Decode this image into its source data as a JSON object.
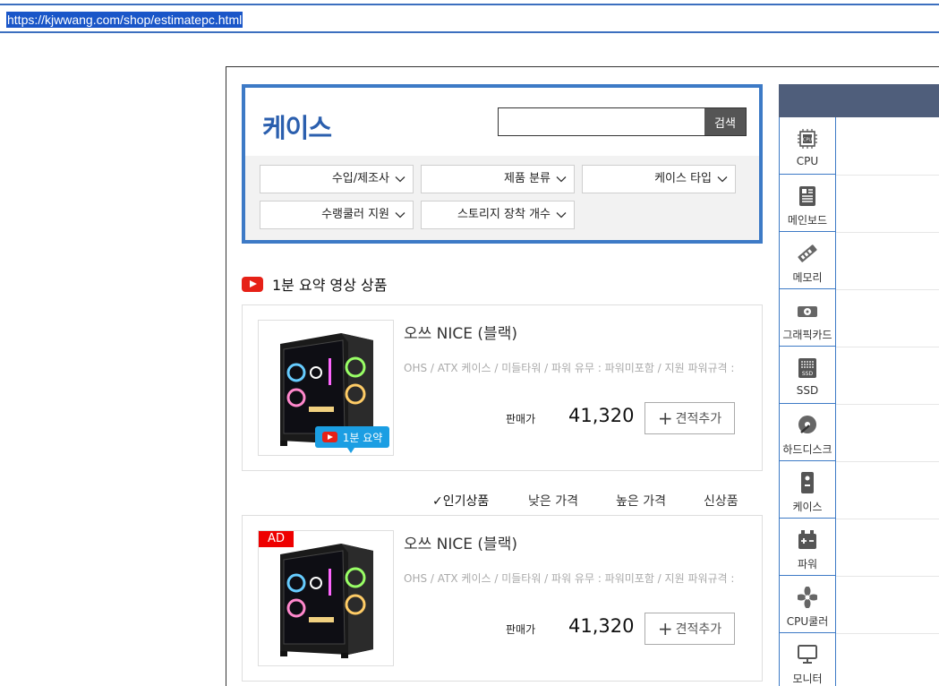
{
  "browser": {
    "url": "https://kjwwang.com/shop/estimatepc.html"
  },
  "category": {
    "title": "케이스",
    "search_placeholder": "",
    "search_button": "검색",
    "filters": [
      "수입/제조사",
      "제품 분류",
      "케이스 타입",
      "수랭쿨러 지원",
      "스토리지 장착 개수"
    ]
  },
  "video_section": {
    "title": "1분 요약 영상 상품"
  },
  "products": [
    {
      "name": "오쓰 NICE (블랙)",
      "spec": "OHS / ATX 케이스 / 미들타워 / 파워 유무 : 파워미포함 / 지원 파워규격 : ATX",
      "price_label": "판매가",
      "price": "41,320",
      "add_label": "견적추가",
      "badge": "1분 요약"
    },
    {
      "name": "오쓰 NICE (블랙)",
      "spec": "OHS / ATX 케이스 / 미들타워 / 파워 유무 : 파워미포함 / 지원 파워규격 : ATX",
      "price_label": "판매가",
      "price": "41,320",
      "add_label": "견적추가",
      "badge": "AD"
    }
  ],
  "sort": {
    "check": "✓",
    "options": [
      "인기상품",
      "낮은 가격",
      "높은 가격",
      "신상품"
    ]
  },
  "sidebar": {
    "items": [
      {
        "label": "CPU",
        "icon": "cpu-icon"
      },
      {
        "label": "메인보드",
        "icon": "mainboard-icon"
      },
      {
        "label": "메모리",
        "icon": "memory-icon"
      },
      {
        "label": "그래픽카드",
        "icon": "graphics-card-icon"
      },
      {
        "label": "SSD",
        "icon": "ssd-icon"
      },
      {
        "label": "하드디스크",
        "icon": "hard-disk-icon"
      },
      {
        "label": "케이스",
        "icon": "case-icon"
      },
      {
        "label": "파워",
        "icon": "power-supply-icon"
      },
      {
        "label": "CPU쿨러",
        "icon": "cpu-cooler-icon"
      },
      {
        "label": "모니터",
        "icon": "monitor-icon"
      }
    ]
  },
  "colors": {
    "accent": "#3d7ac6",
    "title": "#2b5fae",
    "badge_blue": "#1b9ee3",
    "ad_red": "#ee0000",
    "sidebar_header": "#4f5e7b"
  }
}
